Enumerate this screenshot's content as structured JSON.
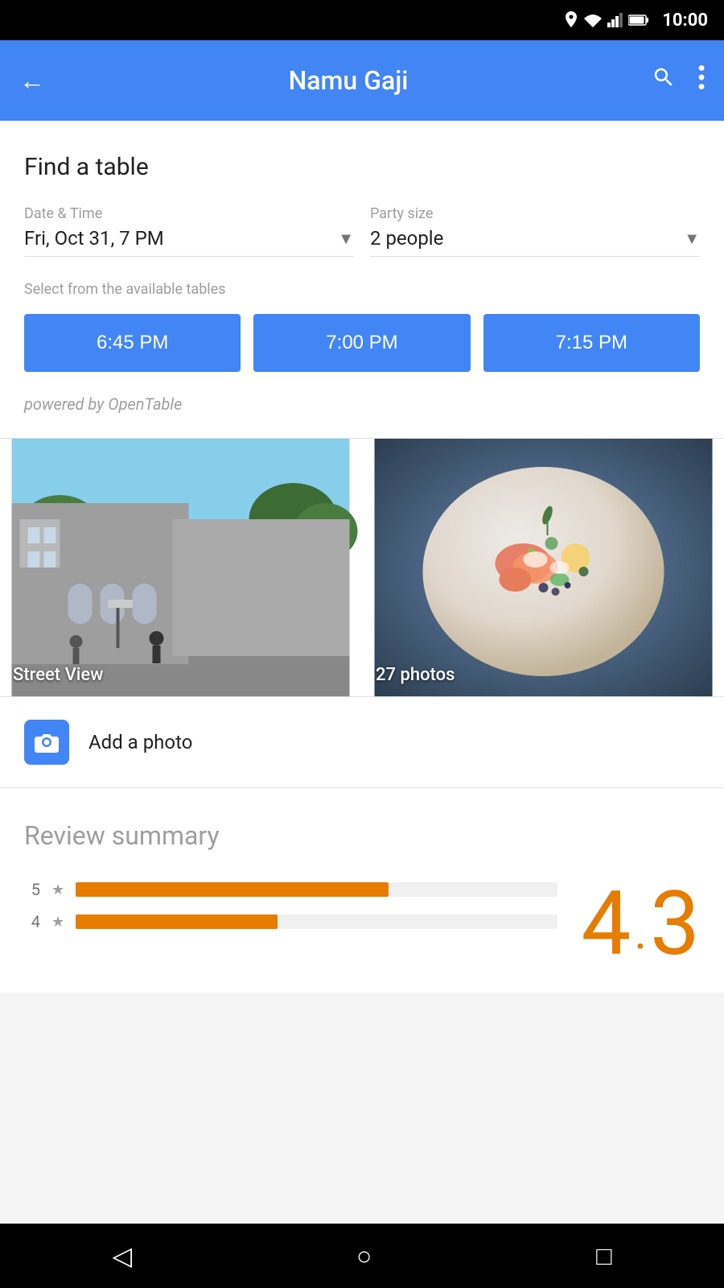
{
  "status_bar": {
    "time": "10:00"
  },
  "app_bar": {
    "back_label": "←",
    "title": "Namu Gaji",
    "search_icon": "search",
    "more_icon": "more_vert"
  },
  "find_table": {
    "title": "Find a table",
    "date_time_label": "Date & Time",
    "date_time_value": "Fri, Oct 31, 7 PM",
    "party_size_label": "Party size",
    "party_size_value": "2 people",
    "available_label": "Select from the available tables",
    "time_slots": [
      "6:45 PM",
      "7:00 PM",
      "7:15 PM"
    ],
    "powered_by": "powered by OpenTable"
  },
  "photos": {
    "street_view_label": "Street View",
    "food_label": "27 photos"
  },
  "add_photo": {
    "label": "Add a photo"
  },
  "review_summary": {
    "title": "Review summary",
    "rating_integer": "4",
    "rating_decimal": ".",
    "rating_fraction": "3",
    "bars": [
      {
        "star": "5",
        "width": 65
      },
      {
        "star": "4",
        "width": 42
      }
    ]
  },
  "bottom_nav": {
    "back_icon": "◁",
    "home_icon": "○",
    "recent_icon": "□"
  }
}
